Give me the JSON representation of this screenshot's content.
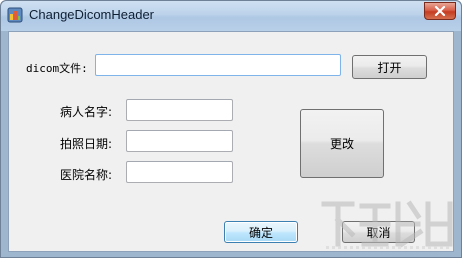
{
  "window": {
    "title": "ChangeDicomHeader",
    "icons": {
      "app": "app-icon",
      "close": "close-icon"
    }
  },
  "form": {
    "dicom_label": "dicom文件:",
    "dicom_value": "",
    "open_button": "打开",
    "patient_label": "病人名字:",
    "patient_value": "",
    "date_label": "拍照日期:",
    "date_value": "",
    "hospital_label": "医院名称:",
    "hospital_value": "",
    "change_button": "更改",
    "ok_button": "确定",
    "cancel_button": "取消"
  },
  "colors": {
    "close_button": "#c43c22",
    "focus_border": "#7eb4ea",
    "default_button_border": "#3c7fb1"
  }
}
